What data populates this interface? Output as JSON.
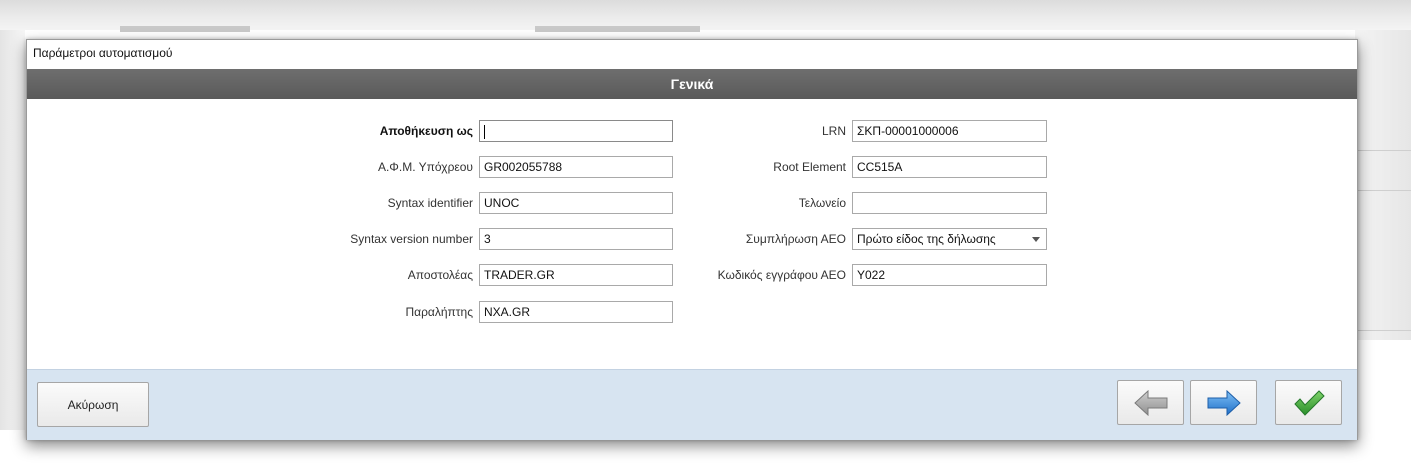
{
  "dialog": {
    "title": "Παράμετροι αυτοματισμού",
    "section_title": "Γενικά"
  },
  "form": {
    "left": [
      {
        "label": "Αποθήκευση ως",
        "value": "",
        "bold": true,
        "focused": true
      },
      {
        "label": "Α.Φ.Μ. Υπόχρεου",
        "value": "GR002055788"
      },
      {
        "label": "Syntax identifier",
        "value": "UNOC"
      },
      {
        "label": "Syntax version number",
        "value": "3"
      },
      {
        "label": "Αποστολέας",
        "value": "TRADER.GR"
      },
      {
        "label": "Παραλήπτης",
        "value": "NXA.GR"
      }
    ],
    "right": [
      {
        "label": "LRN",
        "value": "ΣΚΠ-00001000006"
      },
      {
        "label": "Root Element",
        "value": "CC515A"
      },
      {
        "label": "Τελωνείο",
        "value": ""
      },
      {
        "label": "Συμπλήρωση ΑΕΟ",
        "value": "Πρώτο είδος της δήλωσης",
        "type": "select"
      },
      {
        "label": "Κωδικός εγγράφου ΑΕΟ",
        "value": "Y022"
      }
    ]
  },
  "footer": {
    "cancel_label": "Ακύρωση",
    "back_icon": "arrow-left-icon",
    "next_icon": "arrow-right-icon",
    "ok_icon": "checkmark-icon"
  },
  "colors": {
    "header_bg": "#636363",
    "footer_bg": "#d7e4f1",
    "next_arrow": "#2f7fd6",
    "back_arrow": "#a9a9a9",
    "checkmark": "#3aa23a"
  }
}
